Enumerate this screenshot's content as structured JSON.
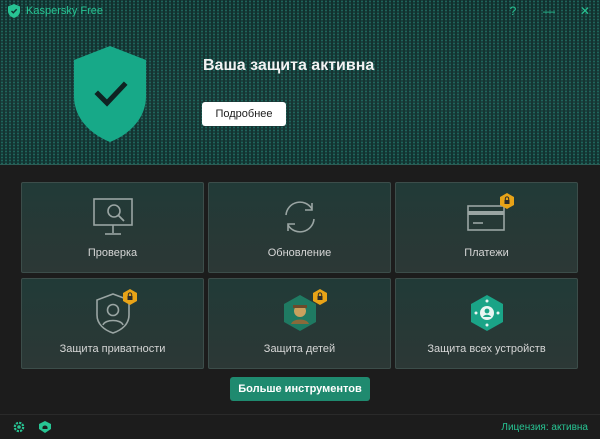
{
  "app": {
    "title": "Kaspersky Free"
  },
  "window_controls": {
    "help": "?",
    "minimize": "—",
    "close": "✕"
  },
  "hero": {
    "headline": "Ваша защита активна",
    "details_button": "Подробнее"
  },
  "tiles": [
    {
      "label": "Проверка",
      "icon": "scan-monitor-icon",
      "locked": false
    },
    {
      "label": "Обновление",
      "icon": "update-arrows-icon",
      "locked": false
    },
    {
      "label": "Платежи",
      "icon": "payment-card-icon",
      "locked": true
    },
    {
      "label": "Защита приватности",
      "icon": "privacy-user-icon",
      "locked": true
    },
    {
      "label": "Защита детей",
      "icon": "child-protection-icon",
      "locked": true
    },
    {
      "label": "Защита всех устройств",
      "icon": "devices-protection-icon",
      "locked": false
    }
  ],
  "more_tools_button": "Больше инструментов",
  "status": {
    "license": "Лицензия: активна"
  },
  "colors": {
    "accent": "#27c493",
    "button_green": "#1f8a6f",
    "shield": "#17a988",
    "lock": "#e8a317"
  }
}
